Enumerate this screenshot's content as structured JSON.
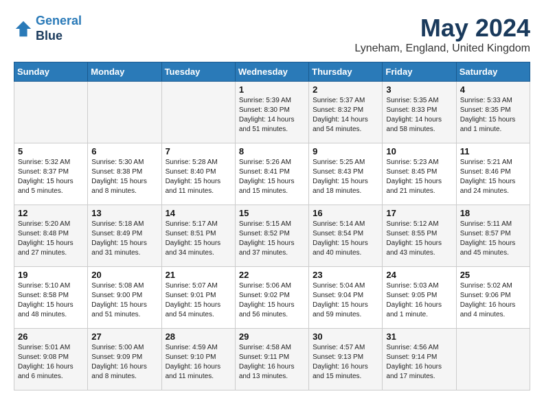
{
  "header": {
    "logo_line1": "General",
    "logo_line2": "Blue",
    "month": "May 2024",
    "location": "Lyneham, England, United Kingdom"
  },
  "weekdays": [
    "Sunday",
    "Monday",
    "Tuesday",
    "Wednesday",
    "Thursday",
    "Friday",
    "Saturday"
  ],
  "weeks": [
    [
      {
        "day": "",
        "info": ""
      },
      {
        "day": "",
        "info": ""
      },
      {
        "day": "",
        "info": ""
      },
      {
        "day": "1",
        "info": "Sunrise: 5:39 AM\nSunset: 8:30 PM\nDaylight: 14 hours\nand 51 minutes."
      },
      {
        "day": "2",
        "info": "Sunrise: 5:37 AM\nSunset: 8:32 PM\nDaylight: 14 hours\nand 54 minutes."
      },
      {
        "day": "3",
        "info": "Sunrise: 5:35 AM\nSunset: 8:33 PM\nDaylight: 14 hours\nand 58 minutes."
      },
      {
        "day": "4",
        "info": "Sunrise: 5:33 AM\nSunset: 8:35 PM\nDaylight: 15 hours\nand 1 minute."
      }
    ],
    [
      {
        "day": "5",
        "info": "Sunrise: 5:32 AM\nSunset: 8:37 PM\nDaylight: 15 hours\nand 5 minutes."
      },
      {
        "day": "6",
        "info": "Sunrise: 5:30 AM\nSunset: 8:38 PM\nDaylight: 15 hours\nand 8 minutes."
      },
      {
        "day": "7",
        "info": "Sunrise: 5:28 AM\nSunset: 8:40 PM\nDaylight: 15 hours\nand 11 minutes."
      },
      {
        "day": "8",
        "info": "Sunrise: 5:26 AM\nSunset: 8:41 PM\nDaylight: 15 hours\nand 15 minutes."
      },
      {
        "day": "9",
        "info": "Sunrise: 5:25 AM\nSunset: 8:43 PM\nDaylight: 15 hours\nand 18 minutes."
      },
      {
        "day": "10",
        "info": "Sunrise: 5:23 AM\nSunset: 8:45 PM\nDaylight: 15 hours\nand 21 minutes."
      },
      {
        "day": "11",
        "info": "Sunrise: 5:21 AM\nSunset: 8:46 PM\nDaylight: 15 hours\nand 24 minutes."
      }
    ],
    [
      {
        "day": "12",
        "info": "Sunrise: 5:20 AM\nSunset: 8:48 PM\nDaylight: 15 hours\nand 27 minutes."
      },
      {
        "day": "13",
        "info": "Sunrise: 5:18 AM\nSunset: 8:49 PM\nDaylight: 15 hours\nand 31 minutes."
      },
      {
        "day": "14",
        "info": "Sunrise: 5:17 AM\nSunset: 8:51 PM\nDaylight: 15 hours\nand 34 minutes."
      },
      {
        "day": "15",
        "info": "Sunrise: 5:15 AM\nSunset: 8:52 PM\nDaylight: 15 hours\nand 37 minutes."
      },
      {
        "day": "16",
        "info": "Sunrise: 5:14 AM\nSunset: 8:54 PM\nDaylight: 15 hours\nand 40 minutes."
      },
      {
        "day": "17",
        "info": "Sunrise: 5:12 AM\nSunset: 8:55 PM\nDaylight: 15 hours\nand 43 minutes."
      },
      {
        "day": "18",
        "info": "Sunrise: 5:11 AM\nSunset: 8:57 PM\nDaylight: 15 hours\nand 45 minutes."
      }
    ],
    [
      {
        "day": "19",
        "info": "Sunrise: 5:10 AM\nSunset: 8:58 PM\nDaylight: 15 hours\nand 48 minutes."
      },
      {
        "day": "20",
        "info": "Sunrise: 5:08 AM\nSunset: 9:00 PM\nDaylight: 15 hours\nand 51 minutes."
      },
      {
        "day": "21",
        "info": "Sunrise: 5:07 AM\nSunset: 9:01 PM\nDaylight: 15 hours\nand 54 minutes."
      },
      {
        "day": "22",
        "info": "Sunrise: 5:06 AM\nSunset: 9:02 PM\nDaylight: 15 hours\nand 56 minutes."
      },
      {
        "day": "23",
        "info": "Sunrise: 5:04 AM\nSunset: 9:04 PM\nDaylight: 15 hours\nand 59 minutes."
      },
      {
        "day": "24",
        "info": "Sunrise: 5:03 AM\nSunset: 9:05 PM\nDaylight: 16 hours\nand 1 minute."
      },
      {
        "day": "25",
        "info": "Sunrise: 5:02 AM\nSunset: 9:06 PM\nDaylight: 16 hours\nand 4 minutes."
      }
    ],
    [
      {
        "day": "26",
        "info": "Sunrise: 5:01 AM\nSunset: 9:08 PM\nDaylight: 16 hours\nand 6 minutes."
      },
      {
        "day": "27",
        "info": "Sunrise: 5:00 AM\nSunset: 9:09 PM\nDaylight: 16 hours\nand 8 minutes."
      },
      {
        "day": "28",
        "info": "Sunrise: 4:59 AM\nSunset: 9:10 PM\nDaylight: 16 hours\nand 11 minutes."
      },
      {
        "day": "29",
        "info": "Sunrise: 4:58 AM\nSunset: 9:11 PM\nDaylight: 16 hours\nand 13 minutes."
      },
      {
        "day": "30",
        "info": "Sunrise: 4:57 AM\nSunset: 9:13 PM\nDaylight: 16 hours\nand 15 minutes."
      },
      {
        "day": "31",
        "info": "Sunrise: 4:56 AM\nSunset: 9:14 PM\nDaylight: 16 hours\nand 17 minutes."
      },
      {
        "day": "",
        "info": ""
      }
    ]
  ]
}
